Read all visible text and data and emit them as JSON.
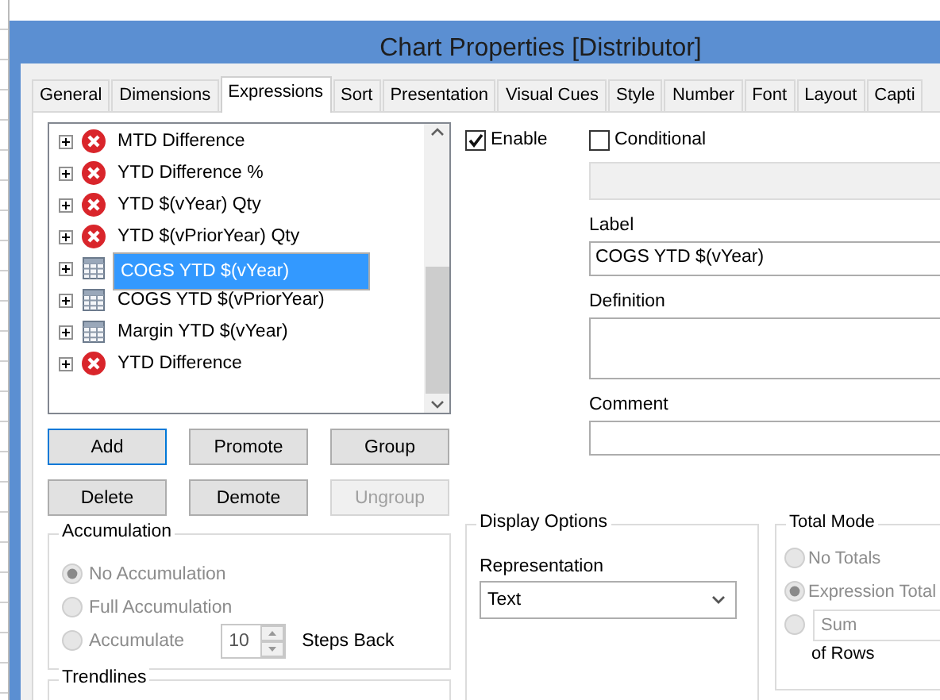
{
  "window": {
    "title": "Chart Properties [Distributor]"
  },
  "tabs": [
    {
      "label": "General",
      "selected": false
    },
    {
      "label": "Dimensions",
      "selected": false
    },
    {
      "label": "Expressions",
      "selected": true
    },
    {
      "label": "Sort",
      "selected": false
    },
    {
      "label": "Presentation",
      "selected": false
    },
    {
      "label": "Visual Cues",
      "selected": false
    },
    {
      "label": "Style",
      "selected": false
    },
    {
      "label": "Number",
      "selected": false
    },
    {
      "label": "Font",
      "selected": false
    },
    {
      "label": "Layout",
      "selected": false
    },
    {
      "label": "Capti",
      "selected": false
    }
  ],
  "expressions": [
    {
      "label": "MTD Difference",
      "kind": "error",
      "selected": false
    },
    {
      "label": "YTD Difference %",
      "kind": "error",
      "selected": false
    },
    {
      "label": "YTD $(vYear) Qty",
      "kind": "error",
      "selected": false
    },
    {
      "label": "YTD $(vPriorYear) Qty",
      "kind": "error",
      "selected": false
    },
    {
      "label": "COGS YTD $(vYear)",
      "kind": "table",
      "selected": true
    },
    {
      "label": "COGS YTD $(vPriorYear)",
      "kind": "table",
      "selected": false
    },
    {
      "label": "Margin YTD $(vYear)",
      "kind": "table",
      "selected": false
    },
    {
      "label": "YTD Difference",
      "kind": "error",
      "selected": false
    }
  ],
  "buttons": [
    {
      "label": "Add",
      "focused": true,
      "disabled": false
    },
    {
      "label": "Promote",
      "focused": false,
      "disabled": false
    },
    {
      "label": "Group",
      "focused": false,
      "disabled": false
    },
    {
      "label": "Delete",
      "focused": false,
      "disabled": false
    },
    {
      "label": "Demote",
      "focused": false,
      "disabled": false
    },
    {
      "label": "Ungroup",
      "focused": false,
      "disabled": true
    }
  ],
  "enable": {
    "label": "Enable",
    "checked": true
  },
  "conditional": {
    "label": "Conditional",
    "checked": false
  },
  "label_field": {
    "caption": "Label",
    "value": "COGS YTD $(vYear)"
  },
  "definition_field": {
    "caption": "Definition"
  },
  "comment_field": {
    "caption": "Comment"
  },
  "accumulation": {
    "title": "Accumulation",
    "disabled": true,
    "options": [
      {
        "label": "No Accumulation",
        "selected": true
      },
      {
        "label": "Full Accumulation",
        "selected": false
      },
      {
        "label": "Accumulate",
        "selected": false
      }
    ],
    "steps": {
      "value": "10",
      "label": "Steps Back"
    }
  },
  "trendlines": {
    "title": "Trendlines"
  },
  "display_options": {
    "title": "Display Options",
    "representation": {
      "caption": "Representation",
      "value": "Text"
    }
  },
  "total_mode": {
    "title": "Total Mode",
    "disabled": true,
    "options": [
      {
        "label": "No Totals",
        "selected": false
      },
      {
        "label": "Expression Total",
        "selected": true
      },
      {
        "value": "Sum",
        "selected": false
      }
    ],
    "suffix": "of Rows"
  }
}
